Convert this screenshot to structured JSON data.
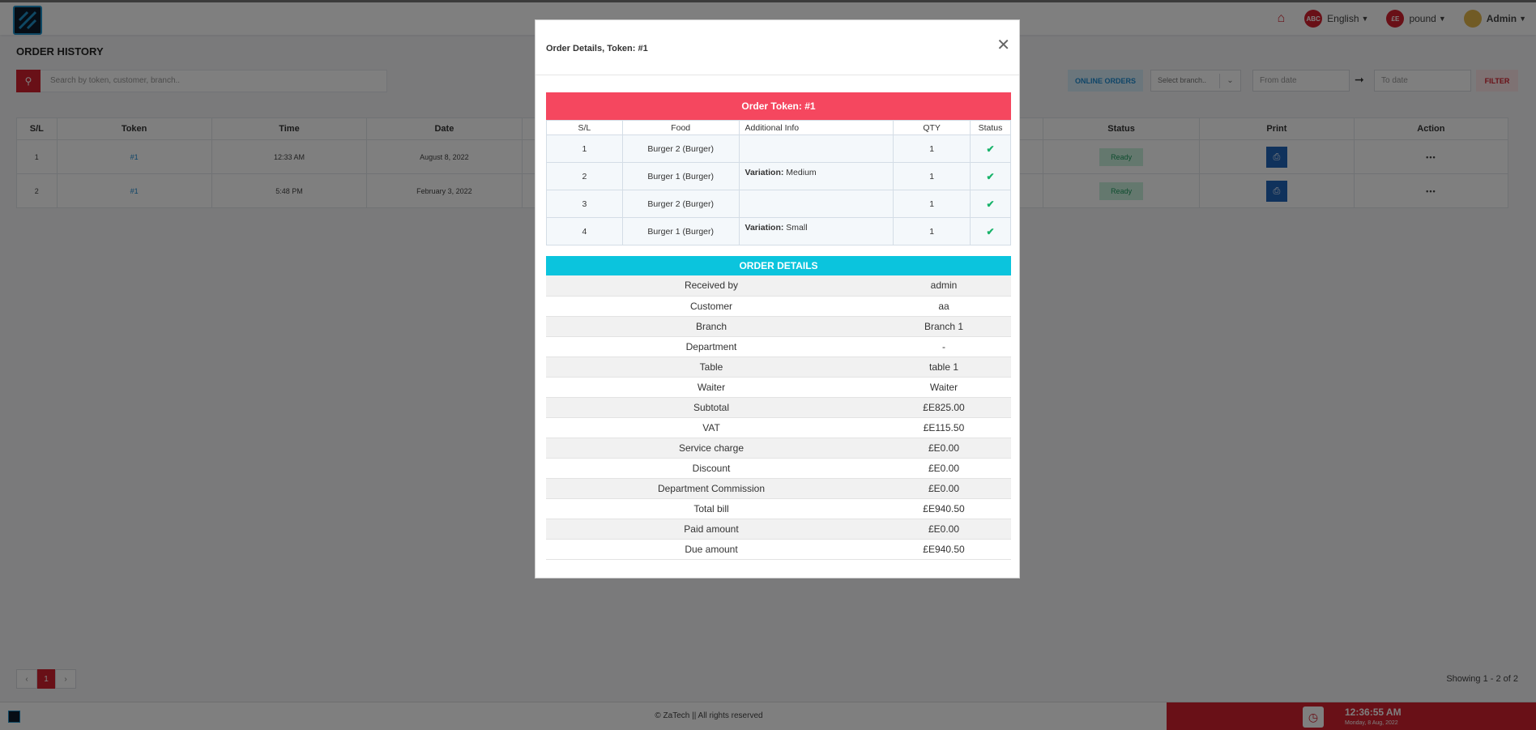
{
  "topbar": {
    "language": "English",
    "language_badge": "ABC",
    "currency": "pound",
    "currency_badge": "£E",
    "user": "Admin"
  },
  "page": {
    "title": "ORDER HISTORY",
    "search_placeholder": "Search by token, customer, branch..",
    "online_orders": "ONLINE ORDERS",
    "branch_placeholder": "Select branch..",
    "from_date": "From date",
    "to_date": "To date",
    "filter": "FILTER"
  },
  "history_table": {
    "headers": {
      "sl": "S/L",
      "token": "Token",
      "time": "Time",
      "date": "Date",
      "status": "Status",
      "print": "Print",
      "action": "Action"
    },
    "rows": [
      {
        "sl": "1",
        "token": "#1",
        "time": "12:33 AM",
        "date": "August 8, 2022",
        "status": "Ready"
      },
      {
        "sl": "2",
        "token": "#1",
        "time": "5:48 PM",
        "date": "February 3, 2022",
        "status": "Ready"
      }
    ]
  },
  "pagination": {
    "prev": "‹",
    "current": "1",
    "next": "›",
    "showing": "Showing 1 - 2 of 2"
  },
  "footer": {
    "copyright": "© ZaTech || All rights reserved",
    "time": "12:36:55 AM",
    "date": "Monday, 8 Aug, 2022"
  },
  "modal": {
    "title": "Order Details, Token: #1",
    "token_heading": "Order Token: #1",
    "item_headers": {
      "sl": "S/L",
      "food": "Food",
      "info": "Additional Info",
      "qty": "QTY",
      "status": "Status"
    },
    "items": [
      {
        "sl": "1",
        "food": "Burger 2 (Burger)",
        "info_label": "",
        "info_value": "",
        "qty": "1"
      },
      {
        "sl": "2",
        "food": "Burger 1 (Burger)",
        "info_label": "Variation:",
        "info_value": " Medium",
        "qty": "1"
      },
      {
        "sl": "3",
        "food": "Burger 2 (Burger)",
        "info_label": "",
        "info_value": "",
        "qty": "1"
      },
      {
        "sl": "4",
        "food": "Burger 1 (Burger)",
        "info_label": "Variation:",
        "info_value": " Small",
        "qty": "1"
      }
    ],
    "details_heading": "ORDER DETAILS",
    "details": [
      {
        "label": "Received by",
        "value": "admin"
      },
      {
        "label": "Customer",
        "value": "aa"
      },
      {
        "label": "Branch",
        "value": "Branch 1"
      },
      {
        "label": "Department",
        "value": "-"
      },
      {
        "label": "Table",
        "value": "table 1"
      },
      {
        "label": "Waiter",
        "value": "Waiter"
      },
      {
        "label": "Subtotal",
        "value": "£E825.00"
      },
      {
        "label": "VAT",
        "value": "£E115.50"
      },
      {
        "label": "Service charge",
        "value": "£E0.00"
      },
      {
        "label": "Discount",
        "value": "£E0.00"
      },
      {
        "label": "Department Commission",
        "value": "£E0.00"
      },
      {
        "label": "Total bill",
        "value": "£E940.50"
      },
      {
        "label": "Paid amount",
        "value": "£E0.00"
      },
      {
        "label": "Due amount",
        "value": "£E940.50"
      }
    ]
  }
}
